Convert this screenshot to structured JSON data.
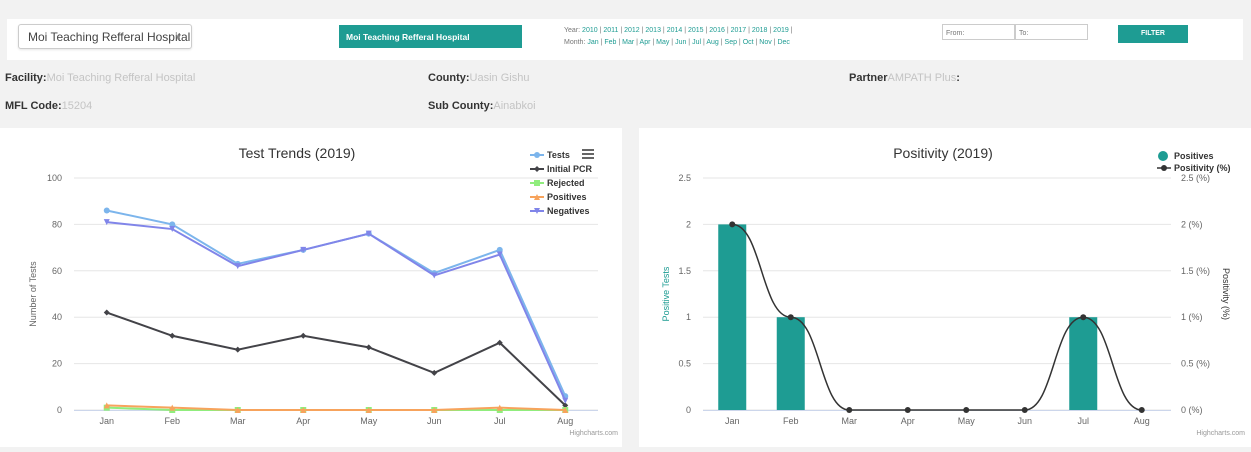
{
  "filters": {
    "facility_select": "Moi Teaching Refferal Hospital",
    "facility_button": "Moi Teaching Refferal Hospital",
    "year_prefix": "Year:",
    "years": [
      "2010",
      "2011",
      "2012",
      "2013",
      "2014",
      "2015",
      "2016",
      "2017",
      "2018",
      "2019"
    ],
    "month_prefix": "Month:",
    "months": [
      "Jan",
      "Feb",
      "Mar",
      "Apr",
      "May",
      "Jun",
      "Jul",
      "Aug",
      "Sep",
      "Oct",
      "Nov",
      "Dec"
    ],
    "from_placeholder": "From:",
    "to_placeholder": "To:",
    "filter_label": "FILTER"
  },
  "info": {
    "facility_label": "Facility:",
    "facility_value": "Moi Teaching Refferal Hospital",
    "county_label": "County:",
    "county_value": "Uasin Gishu",
    "partner_label": "Partner",
    "partner_value": "AMPATH Plus",
    "partner_suffix": ":",
    "mfl_label": "MFL Code:",
    "mfl_value": "15204",
    "subcounty_label": "Sub County:",
    "subcounty_value": "Ainabkoi"
  },
  "credits": "Highcharts.com",
  "chart_data": [
    {
      "type": "line",
      "title": "Test Trends (2019)",
      "xlabel": "",
      "ylabel": "Number of Tests",
      "categories": [
        "Jan",
        "Feb",
        "Mar",
        "Apr",
        "May",
        "Jun",
        "Jul",
        "Aug"
      ],
      "ylim": [
        0,
        100
      ],
      "yticks": [
        0,
        20,
        40,
        60,
        80,
        100
      ],
      "legend_position": "top-right",
      "series": [
        {
          "name": "Tests",
          "color": "#7cb5ec",
          "marker": "circle",
          "values": [
            86,
            80,
            63,
            69,
            76,
            59,
            69,
            6
          ]
        },
        {
          "name": "Initial PCR",
          "color": "#434348",
          "marker": "diamond",
          "values": [
            42,
            32,
            26,
            32,
            27,
            16,
            29,
            2
          ]
        },
        {
          "name": "Rejected",
          "color": "#90ed7d",
          "marker": "square",
          "values": [
            1,
            0,
            0,
            0,
            0,
            0,
            0,
            0
          ]
        },
        {
          "name": "Positives",
          "color": "#f7a35c",
          "marker": "triangle",
          "values": [
            2,
            1,
            0,
            0,
            0,
            0,
            1,
            0
          ]
        },
        {
          "name": "Negatives",
          "color": "#8085e9",
          "marker": "triangle-down",
          "values": [
            81,
            78,
            62,
            69,
            76,
            58,
            67,
            4
          ]
        }
      ]
    },
    {
      "type": "bar",
      "title": "Positivity (2019)",
      "categories": [
        "Jan",
        "Feb",
        "Mar",
        "Apr",
        "May",
        "Jun",
        "Jul",
        "Aug"
      ],
      "ylabel": "Positive Tests",
      "ylim": [
        0,
        2.5
      ],
      "yticks": [
        0,
        0.5,
        1,
        1.5,
        2,
        2.5
      ],
      "y2label": "Positivity (%)",
      "y2lim": [
        0,
        2.5
      ],
      "y2ticks": [
        "0 (%)",
        "0.5 (%)",
        "1 (%)",
        "1.5 (%)",
        "2 (%)",
        "2.5 (%)"
      ],
      "legend_position": "top-right",
      "series": [
        {
          "name": "Positives",
          "kind": "column",
          "color": "#1e9c93",
          "values": [
            2,
            1,
            0,
            0,
            0,
            0,
            1,
            0
          ]
        },
        {
          "name": "Positivity (%)",
          "kind": "spline",
          "color": "#333333",
          "values": [
            2,
            1,
            0,
            0,
            0,
            0,
            1,
            0
          ]
        }
      ]
    }
  ]
}
